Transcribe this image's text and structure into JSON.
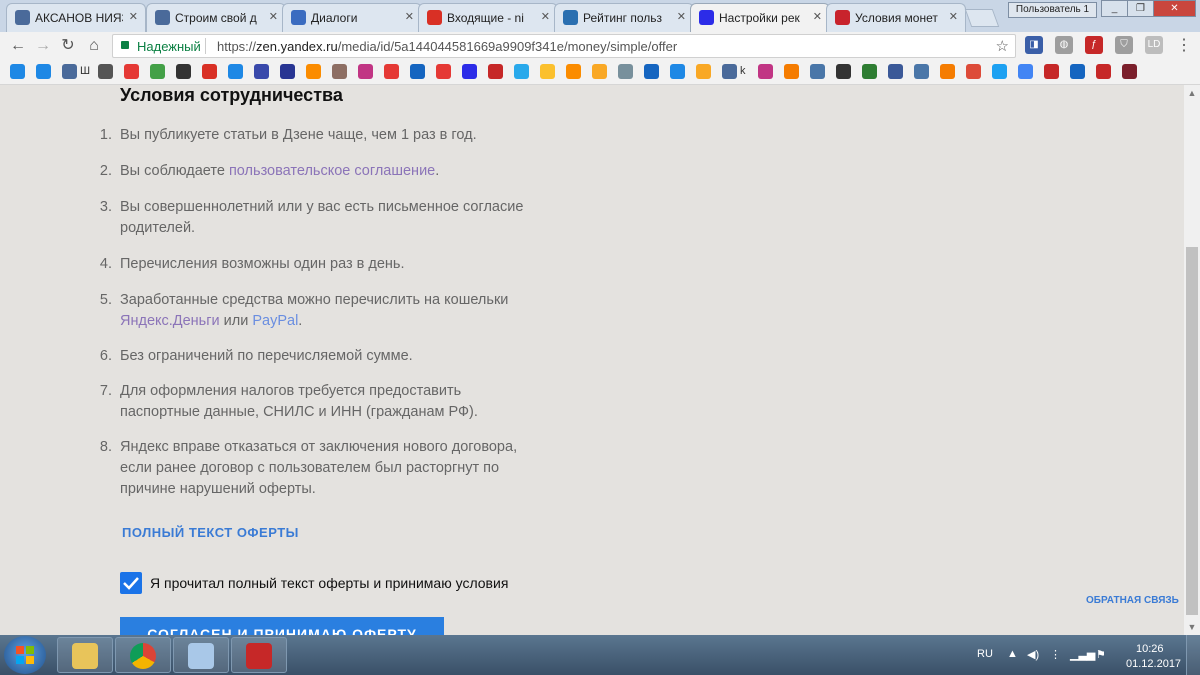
{
  "browser": {
    "tabs": [
      {
        "title": "АКСАНОВ НИЯЗ",
        "icon": "user-icon",
        "color": "#4a6a9a"
      },
      {
        "title": "Строим свой д",
        "icon": "user-icon",
        "color": "#4a6a9a"
      },
      {
        "title": "Диалоги",
        "icon": "chat-icon",
        "color": "#3b6cc0"
      },
      {
        "title": "Входящие - ni",
        "icon": "gmail-icon",
        "color": "#d93025"
      },
      {
        "title": "Рейтинг польз",
        "icon": "rating-icon",
        "color": "#2a6fb0"
      },
      {
        "title": "Настройки рек",
        "icon": "zen-icon",
        "color": "#2c2ce8"
      },
      {
        "title": "Условия монет",
        "icon": "pinterest-icon",
        "color": "#c8232c"
      }
    ],
    "profile_label": "Пользователь 1",
    "window_buttons": {
      "minimize": "_",
      "restore": "❐",
      "close": "✕"
    },
    "omnibox": {
      "secure_label": "Надежный",
      "url_scheme": "https://",
      "url_host": "zen.yandex.ru",
      "url_path": "/media/id/5a144044581669a9909f341e/money/simple/offer"
    },
    "bookmarks": [
      {
        "icon": "drop-icon",
        "color": "#1e88e5"
      },
      {
        "icon": "drop-icon",
        "color": "#1e88e5"
      },
      {
        "icon": "user-icon",
        "color": "#4a6a9a",
        "text": "Ш"
      },
      {
        "icon": "plane-icon",
        "color": "#555"
      },
      {
        "icon": "location-pin-icon",
        "color": "#e53935"
      },
      {
        "icon": "circle-arrow-icon",
        "color": "#43a047"
      },
      {
        "icon": "b-icon",
        "color": "#333"
      },
      {
        "icon": "gmail-icon",
        "color": "#d93025"
      },
      {
        "icon": "check-icon",
        "color": "#1e88e5"
      },
      {
        "icon": "bl-icon",
        "color": "#3949ab"
      },
      {
        "icon": "heart-icon",
        "color": "#283593"
      },
      {
        "icon": "ru-icon",
        "color": "#fb8c00"
      },
      {
        "icon": "acorn-icon",
        "color": "#8d6e63"
      },
      {
        "icon": "instagram-icon",
        "color": "#c13584"
      },
      {
        "icon": "ld-icon",
        "color": "#e53935"
      },
      {
        "icon": "arrow-icon",
        "color": "#1565c0"
      },
      {
        "icon": "bars-icon",
        "color": "#e53935"
      },
      {
        "icon": "zen-icon",
        "color": "#2c2ce8"
      },
      {
        "icon": "d-icon",
        "color": "#c62828"
      },
      {
        "icon": "telegram-icon",
        "color": "#29a9eb"
      },
      {
        "icon": "hand-icon",
        "color": "#fbc02d"
      },
      {
        "icon": "q-icon",
        "color": "#fb8c00"
      },
      {
        "icon": "chart-icon",
        "color": "#f9a825"
      },
      {
        "icon": "globe-icon",
        "color": "#78909c"
      },
      {
        "icon": "arrow-icon",
        "color": "#1565c0"
      },
      {
        "icon": "translate-icon",
        "color": "#1e88e5"
      },
      {
        "icon": "at-icon",
        "color": "#f9a825"
      },
      {
        "icon": "user-icon",
        "color": "#4a6a9a",
        "text": "k"
      },
      {
        "icon": "instagram-icon",
        "color": "#c13584"
      },
      {
        "icon": "ok-icon",
        "color": "#f57c00"
      },
      {
        "icon": "vk-icon",
        "color": "#4a76a8"
      },
      {
        "icon": "circle-icon",
        "color": "#333"
      },
      {
        "icon": "leaf-icon",
        "color": "#2e7d32"
      },
      {
        "icon": "facebook-icon",
        "color": "#3b5998"
      },
      {
        "icon": "vk-icon",
        "color": "#4a76a8"
      },
      {
        "icon": "ok-icon",
        "color": "#f57c00"
      },
      {
        "icon": "google-plus-icon",
        "color": "#dd4b39"
      },
      {
        "icon": "twitter-icon",
        "color": "#1da1f2"
      },
      {
        "icon": "google-icon",
        "color": "#4285f4"
      },
      {
        "icon": "v-icon",
        "color": "#c62828"
      },
      {
        "icon": "l-icon",
        "color": "#1565c0"
      },
      {
        "icon": "redhat-icon",
        "color": "#c62828"
      },
      {
        "icon": "f-icon",
        "color": "#7b1f2b"
      }
    ]
  },
  "page": {
    "heading": "Условия сотрудничества",
    "items": [
      {
        "num": "1.",
        "parts": [
          {
            "t": "Вы публикуете статьи в Дзене чаще, чем 1 раз в год."
          }
        ]
      },
      {
        "num": "2.",
        "parts": [
          {
            "t": "Вы соблюдаете "
          },
          {
            "t": "пользовательское соглашение",
            "link": "purple"
          },
          {
            "t": "."
          }
        ]
      },
      {
        "num": "3.",
        "parts": [
          {
            "t": "Вы совершеннолетний или у вас есть письменное согласие родителей."
          }
        ]
      },
      {
        "num": "4.",
        "parts": [
          {
            "t": "Перечисления возможны один раз в день."
          }
        ]
      },
      {
        "num": "5.",
        "parts": [
          {
            "t": "Заработанные средства можно перечислить на кошельки "
          },
          {
            "t": "Яндекс.Деньги",
            "link": "purple"
          },
          {
            "t": " или "
          },
          {
            "t": "PayPal",
            "link": "blue"
          },
          {
            "t": "."
          }
        ]
      },
      {
        "num": "6.",
        "parts": [
          {
            "t": "Без ограничений по перечисляемой сумме."
          }
        ]
      },
      {
        "num": "7.",
        "parts": [
          {
            "t": "Для оформления налогов требуется предоставить паспортные данные, СНИЛС и ИНН (гражданам РФ)."
          }
        ]
      },
      {
        "num": "8.",
        "parts": [
          {
            "t": "Яндекс вправе отказаться от заключения нового договора, если ранее договор с пользователем был расторгнут по причине нарушений оферты."
          }
        ]
      }
    ],
    "full_text_link": "ПОЛНЫЙ ТЕКСТ ОФЕРТЫ",
    "agree_checkbox": {
      "checked": true,
      "label": "Я прочитал полный текст оферты и принимаю условия"
    },
    "feedback_link": "ОБРАТНАЯ СВЯЗЬ",
    "accept_button": "СОГЛАСЕН И ПРИНИМАЮ ОФЕРТУ"
  },
  "taskbar": {
    "apps": [
      {
        "icon": "file-explorer-icon",
        "color": "#e8c45a"
      },
      {
        "icon": "chrome-icon",
        "color": "#4caf50"
      },
      {
        "icon": "notepad-icon",
        "color": "#a9c8e8"
      },
      {
        "icon": "acrobat-icon",
        "color": "#c62828"
      }
    ],
    "language": "RU",
    "time": "10:26",
    "date": "01.12.2017"
  }
}
